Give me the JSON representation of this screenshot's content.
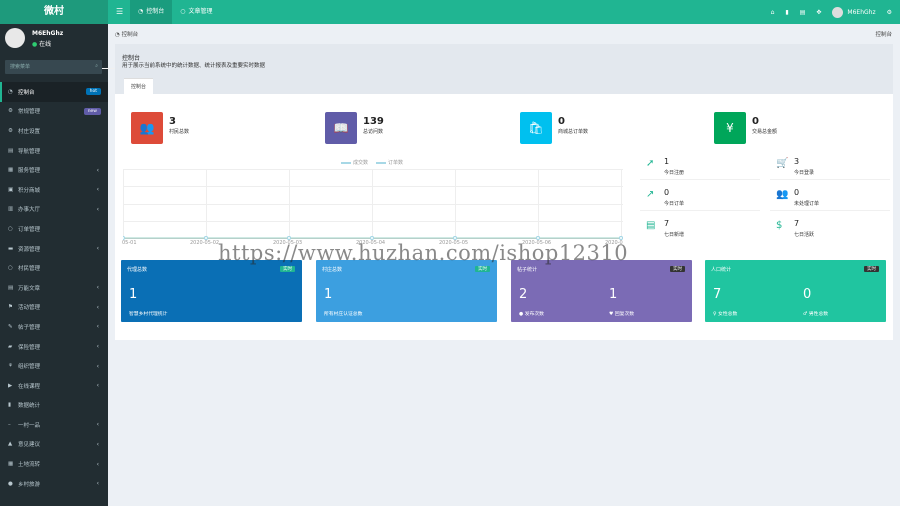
{
  "app": {
    "logo": "微村"
  },
  "topbar": {
    "menu_icon": "menu-icon",
    "tabs": [
      {
        "label": "控制台",
        "icon": "dashboard-icon"
      },
      {
        "label": "文章管理",
        "icon": "circle-icon"
      }
    ],
    "username": "M6EhGhz",
    "icons": [
      "home-icon",
      "trash-icon",
      "document-icon",
      "fullscreen-icon",
      "settings-icon"
    ]
  },
  "sidebar": {
    "user": {
      "name": "M6EhGhz",
      "status": "在线"
    },
    "search_placeholder": "搜索菜单",
    "items": [
      {
        "label": "控制台",
        "badge": "hot"
      },
      {
        "label": "常规管理",
        "badge": "new"
      },
      {
        "label": "村庄设置"
      },
      {
        "label": "导航管理"
      },
      {
        "label": "服务管理"
      },
      {
        "label": "积分商城"
      },
      {
        "label": "办事大厅"
      },
      {
        "label": "订单管理"
      },
      {
        "label": "资源管理"
      },
      {
        "label": "村民管理"
      },
      {
        "label": "万能文章"
      },
      {
        "label": "活动管理"
      },
      {
        "label": "帖子管理"
      },
      {
        "label": "保险管理"
      },
      {
        "label": "组织管理"
      },
      {
        "label": "在线课程"
      },
      {
        "label": "数据统计"
      },
      {
        "label": "一村一品"
      },
      {
        "label": "意见建议"
      },
      {
        "label": "土地流转"
      },
      {
        "label": "乡村旅游"
      }
    ]
  },
  "breadcrumb": {
    "left": "控制台",
    "right": "控制台"
  },
  "header": {
    "title": "控制台",
    "description": "用于展示当前系统中的统计数据、统计报表及重要实时数据",
    "tab": "控制台"
  },
  "infoboxes": [
    {
      "value": "3",
      "label": "村民总数",
      "color": "#dd4b39",
      "icon": "users-icon"
    },
    {
      "value": "139",
      "label": "总访问数",
      "color": "#605ca8",
      "icon": "book-icon"
    },
    {
      "value": "0",
      "label": "商城总订单数",
      "color": "#00c0ef",
      "icon": "shopping-bag-icon"
    },
    {
      "value": "0",
      "label": "交易总金额",
      "color": "#00a65a",
      "icon": "yen-icon"
    }
  ],
  "chart_data": {
    "type": "line",
    "series": [
      {
        "name": "成交数",
        "values": [
          0,
          0,
          0,
          0,
          0,
          0,
          0
        ]
      },
      {
        "name": "订单数",
        "values": [
          0,
          0,
          0,
          0,
          0,
          0,
          0
        ]
      }
    ],
    "x_ticks": [
      "05-01",
      "2020-05-02",
      "2020-05-03",
      "2020-05-04",
      "2020-05-05",
      "2020-05-06",
      "2020-0"
    ]
  },
  "stats": [
    {
      "value": "1",
      "label": "今日注册",
      "icon": "rocket-icon"
    },
    {
      "value": "3",
      "label": "今日登录",
      "icon": "cart-icon"
    },
    {
      "value": "0",
      "label": "今日订单",
      "icon": "area-chart-icon"
    },
    {
      "value": "0",
      "label": "未处理订单",
      "icon": "users-icon"
    },
    {
      "value": "7",
      "label": "七日新增",
      "icon": "calendar-icon"
    },
    {
      "value": "7",
      "label": "七日活跃",
      "icon": "dollar-icon"
    }
  ],
  "cards": [
    {
      "title": "代理总数",
      "tag": "实时",
      "num1": "1",
      "sub1": "智慧乡村代理统计",
      "color": "#0a6fb5"
    },
    {
      "title": "村庄总数",
      "tag": "实时",
      "num1": "1",
      "sub1": "所有村庄认证总数",
      "color": "#3c9fe0"
    },
    {
      "title": "帖子统计",
      "tag": "实时",
      "num1": "2",
      "sub1": "发布次数",
      "num2": "1",
      "sub2": "回复次数",
      "color": "#7b6bb5"
    },
    {
      "title": "人口统计",
      "tag": "实时",
      "num1": "7",
      "sub1": "女性总数",
      "num2": "0",
      "sub2": "男性总数",
      "color": "#20c5a0"
    }
  ],
  "watermark": "https://www.huzhan.com/ishop12310"
}
